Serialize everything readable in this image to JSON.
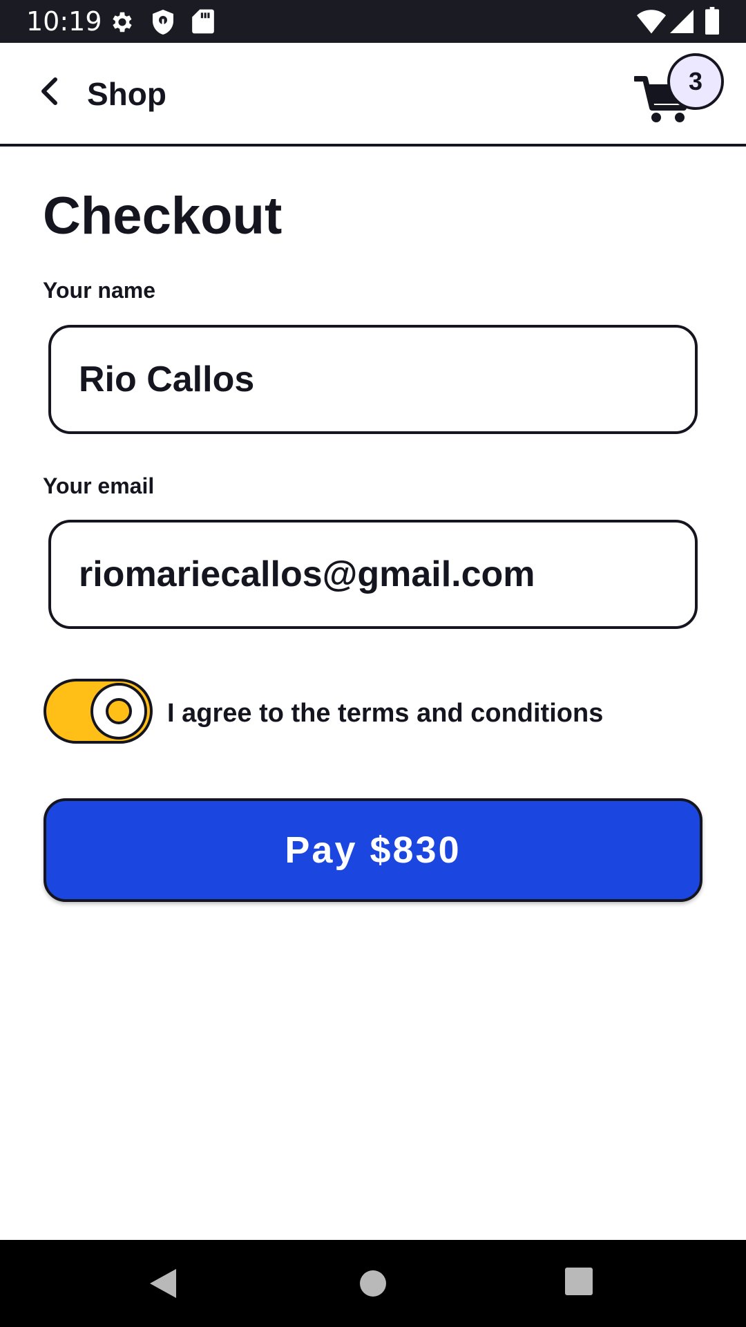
{
  "status_bar": {
    "time": "10:19",
    "icons": [
      "settings-icon",
      "shield-icon",
      "sd-card-icon",
      "wifi-icon",
      "signal-icon",
      "battery-icon"
    ]
  },
  "app_bar": {
    "title": "Shop",
    "back_icon": "back-arrow-icon",
    "cart_icon": "shopping-cart-icon",
    "cart_count": "3"
  },
  "main": {
    "page_title": "Checkout",
    "name_label": "Your name",
    "name_value": "Rio Callos",
    "email_label": "Your email",
    "email_value": "riomariecallos@gmail.com",
    "terms_label": "I agree to the terms and conditions",
    "terms_checked": true,
    "pay_label": "Pay $830"
  },
  "nav_bar": {
    "icons": [
      "nav-back-icon",
      "nav-home-icon",
      "nav-recents-icon"
    ]
  },
  "colors": {
    "text": "#15151f",
    "toggle_on": "#ffbf17",
    "primary_button": "#1b46e0",
    "badge_bg": "#ebe8ff",
    "status_bar": "#1b1b24"
  }
}
